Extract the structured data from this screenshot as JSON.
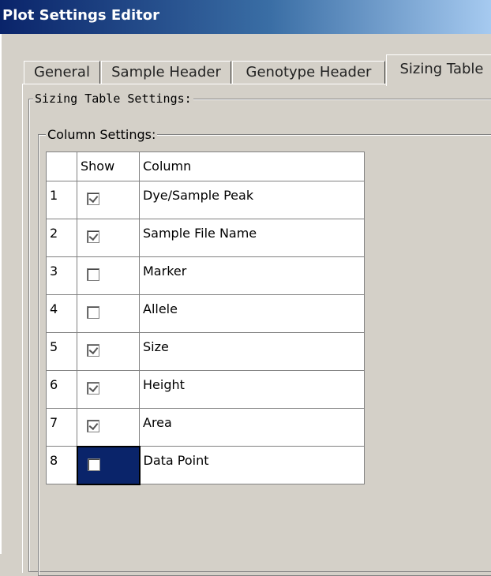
{
  "window": {
    "title": "Plot Settings Editor"
  },
  "tabs": [
    {
      "label": "General",
      "active": false
    },
    {
      "label": "Sample Header",
      "active": false
    },
    {
      "label": "Genotype Header",
      "active": false
    },
    {
      "label": "Sizing Table",
      "active": true
    }
  ],
  "groups": {
    "sizing_table_settings": "Sizing Table Settings:",
    "column_settings": "Column Settings:"
  },
  "grid": {
    "headers": [
      "",
      "Show",
      "Column"
    ],
    "rows": [
      {
        "num": "1",
        "show": true,
        "column": "Dye/Sample Peak"
      },
      {
        "num": "2",
        "show": true,
        "column": "Sample File Name"
      },
      {
        "num": "3",
        "show": false,
        "column": "Marker"
      },
      {
        "num": "4",
        "show": false,
        "column": "Allele"
      },
      {
        "num": "5",
        "show": true,
        "column": "Size"
      },
      {
        "num": "6",
        "show": true,
        "column": "Height"
      },
      {
        "num": "7",
        "show": true,
        "column": "Area"
      },
      {
        "num": "8",
        "show": false,
        "column": "Data Point",
        "selected": true
      }
    ]
  }
}
